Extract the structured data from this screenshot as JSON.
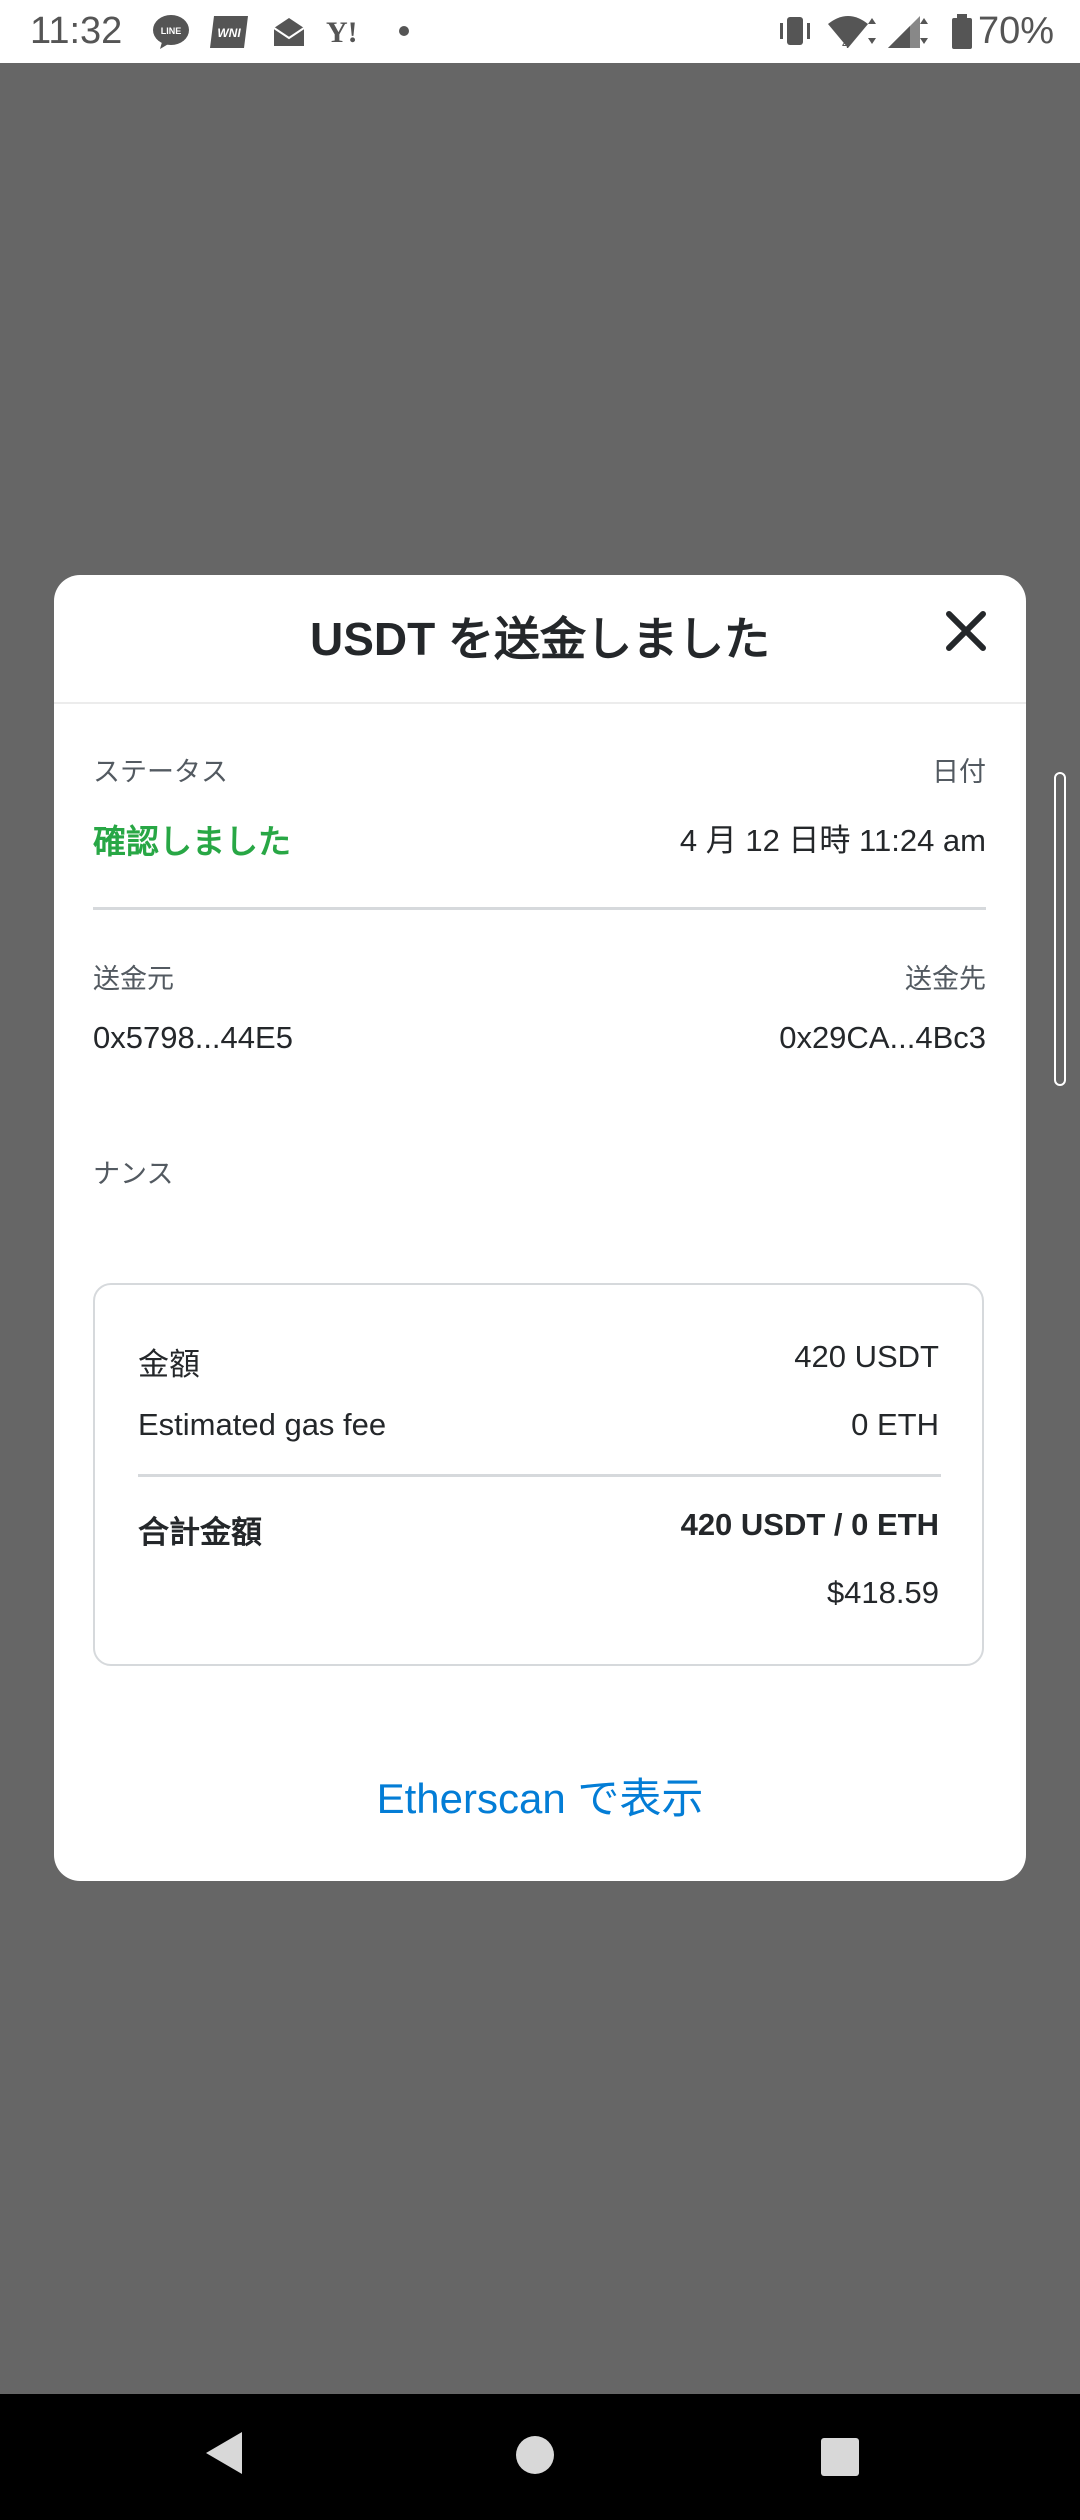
{
  "status_bar": {
    "time": "11:32",
    "notification_icons": [
      "line-icon",
      "wni-icon",
      "mail-icon",
      "yahoo-icon",
      "dot-icon"
    ],
    "battery_percent": "70%"
  },
  "modal": {
    "title": "USDT を送金しました",
    "status_label": "ステータス",
    "status_value": "確認しました",
    "date_label": "日付",
    "date_value": "4 月 12 日時 11:24 am",
    "from_label": "送金元",
    "from_value": "0x5798...44E5",
    "to_label": "送金先",
    "to_value": "0x29CA...4Bc3",
    "nonce_label": "ナンス",
    "summary": {
      "amount_label": "金額",
      "amount_value": "420 USDT",
      "gas_label": "Estimated gas fee",
      "gas_value": "0 ETH",
      "total_label": "合計金額",
      "total_value": "420 USDT / 0 ETH",
      "total_fiat": "$418.59"
    },
    "etherscan_link": "Etherscan で表示"
  },
  "colors": {
    "status_green": "#28a745",
    "link_blue": "#037dd6",
    "overlay": "#666666"
  }
}
